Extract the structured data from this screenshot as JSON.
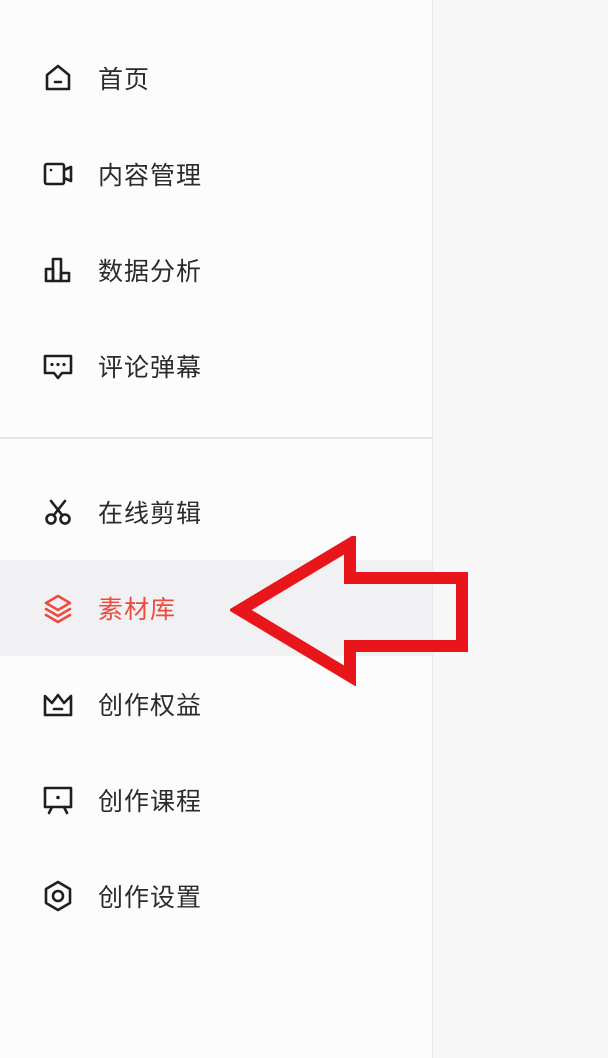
{
  "sidebar": {
    "group1": [
      {
        "label": "首页",
        "icon": "home-icon"
      },
      {
        "label": "内容管理",
        "icon": "video-camera-icon"
      },
      {
        "label": "数据分析",
        "icon": "bar-chart-icon"
      },
      {
        "label": "评论弹幕",
        "icon": "comment-icon"
      }
    ],
    "group2": [
      {
        "label": "在线剪辑",
        "icon": "scissors-icon"
      },
      {
        "label": "素材库",
        "icon": "layers-icon",
        "active": true
      },
      {
        "label": "创作权益",
        "icon": "crown-icon"
      },
      {
        "label": "创作课程",
        "icon": "presentation-icon"
      },
      {
        "label": "创作设置",
        "icon": "hex-gear-icon"
      }
    ]
  },
  "colors": {
    "active_text": "#ee4b3f",
    "arrow": "#e8161b",
    "text": "#2b2b2e",
    "icon": "#1f1f22"
  },
  "annotation": {
    "icon": "red-arrow-pointing-left"
  }
}
